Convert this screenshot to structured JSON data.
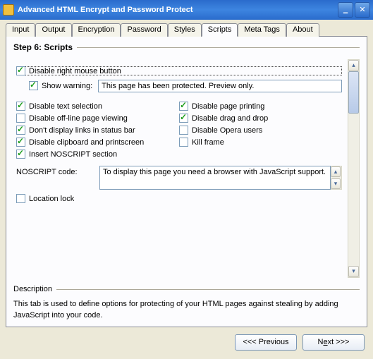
{
  "title": "Advanced HTML Encrypt and Password Protect",
  "tabs": [
    "Input",
    "Output",
    "Encryption",
    "Password",
    "Styles",
    "Scripts",
    "Meta Tags",
    "About"
  ],
  "active_tab": 5,
  "step_title": "Step 6: Scripts",
  "opt": {
    "disable_rmb": "Disable right mouse button",
    "show_warning": "Show warning:",
    "warning_text": "This page has been protected. Preview only.",
    "disable_text_sel": "Disable text selection",
    "disable_page_print": "Disable page printing",
    "disable_offline": "Disable off-line page viewing",
    "disable_dragdrop": "Disable drag and drop",
    "no_links_status": "Don't display links in status bar",
    "disable_opera": "Disable Opera users",
    "disable_clip_ps": "Disable clipboard and printscreen",
    "kill_frame": "Kill frame",
    "insert_noscript": "Insert NOSCRIPT section",
    "noscript_label": "NOSCRIPT code:",
    "noscript_text": "To display this page you need a browser with JavaScript support.",
    "location_lock": "Location lock"
  },
  "desc_label": "Description",
  "desc_text": "This tab is used to define options for protecting of your HTML pages against stealing by adding JavaScript into your code.",
  "btn_prev": "<<<  Previous",
  "btn_next_pre": "N",
  "btn_next_u": "e",
  "btn_next_post": "xt >>>"
}
